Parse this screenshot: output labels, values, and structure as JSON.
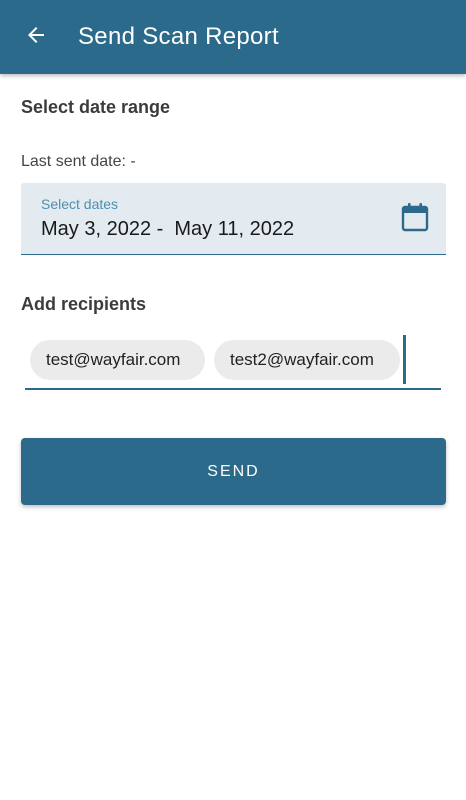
{
  "app_bar": {
    "back_icon": "arrow-left-icon",
    "title": "Send Scan Report",
    "background_color": "#2b6a8a"
  },
  "date_section": {
    "heading": "Select date range",
    "last_sent": "Last sent date: -",
    "field": {
      "label": "Select dates",
      "value": "May 3, 2022 -  May 11, 2022",
      "icon": "calendar-icon"
    }
  },
  "recipients_section": {
    "heading": "Add recipients",
    "chips": [
      {
        "label": "test@wayfair.com"
      },
      {
        "label": "test2@wayfair.com"
      }
    ]
  },
  "send_button": {
    "label": "SEND"
  },
  "colors": {
    "primary": "#2b6a8a",
    "field_background": "#e3ebf0",
    "chip_background": "#ebebeb"
  }
}
